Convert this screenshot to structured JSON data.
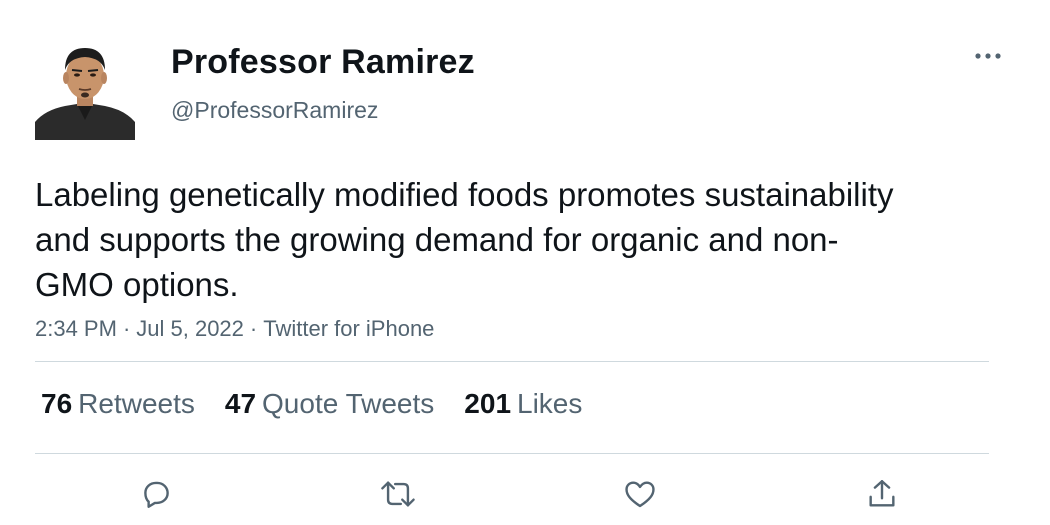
{
  "author": {
    "display_name": "Professor Ramirez",
    "handle": "@ProfessorRamirez"
  },
  "tweet": {
    "text": "Labeling genetically modified foods promotes sustainability and supports the growing demand for organic and non-GMO options.",
    "time": "2:34 PM",
    "date": "Jul 5, 2022",
    "source": "Twitter for iPhone",
    "separator": "·"
  },
  "stats": {
    "retweets": {
      "count": "76",
      "label": "Retweets"
    },
    "quote_tweets": {
      "count": "47",
      "label": "Quote Tweets"
    },
    "likes": {
      "count": "201",
      "label": "Likes"
    }
  },
  "icons": {
    "more": "more-horizontal-icon",
    "reply": "reply-icon",
    "retweet": "retweet-icon",
    "like": "like-icon",
    "share": "share-icon"
  },
  "colors": {
    "text_primary": "#0f1419",
    "text_secondary": "#536471",
    "divider": "#cfd9de"
  }
}
